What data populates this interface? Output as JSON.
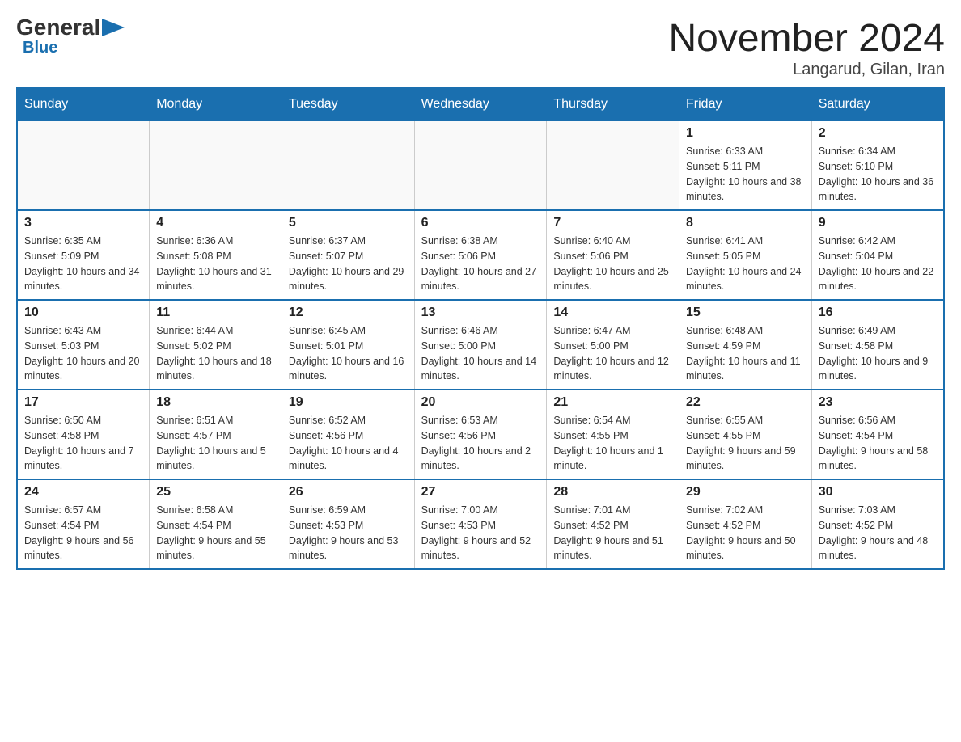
{
  "logo": {
    "general": "General",
    "blue": "Blue",
    "triangle_char": "▶"
  },
  "title": "November 2024",
  "subtitle": "Langarud, Gilan, Iran",
  "days_of_week": [
    "Sunday",
    "Monday",
    "Tuesday",
    "Wednesday",
    "Thursday",
    "Friday",
    "Saturday"
  ],
  "weeks": [
    [
      {
        "day": "",
        "info": ""
      },
      {
        "day": "",
        "info": ""
      },
      {
        "day": "",
        "info": ""
      },
      {
        "day": "",
        "info": ""
      },
      {
        "day": "",
        "info": ""
      },
      {
        "day": "1",
        "info": "Sunrise: 6:33 AM\nSunset: 5:11 PM\nDaylight: 10 hours and 38 minutes."
      },
      {
        "day": "2",
        "info": "Sunrise: 6:34 AM\nSunset: 5:10 PM\nDaylight: 10 hours and 36 minutes."
      }
    ],
    [
      {
        "day": "3",
        "info": "Sunrise: 6:35 AM\nSunset: 5:09 PM\nDaylight: 10 hours and 34 minutes."
      },
      {
        "day": "4",
        "info": "Sunrise: 6:36 AM\nSunset: 5:08 PM\nDaylight: 10 hours and 31 minutes."
      },
      {
        "day": "5",
        "info": "Sunrise: 6:37 AM\nSunset: 5:07 PM\nDaylight: 10 hours and 29 minutes."
      },
      {
        "day": "6",
        "info": "Sunrise: 6:38 AM\nSunset: 5:06 PM\nDaylight: 10 hours and 27 minutes."
      },
      {
        "day": "7",
        "info": "Sunrise: 6:40 AM\nSunset: 5:06 PM\nDaylight: 10 hours and 25 minutes."
      },
      {
        "day": "8",
        "info": "Sunrise: 6:41 AM\nSunset: 5:05 PM\nDaylight: 10 hours and 24 minutes."
      },
      {
        "day": "9",
        "info": "Sunrise: 6:42 AM\nSunset: 5:04 PM\nDaylight: 10 hours and 22 minutes."
      }
    ],
    [
      {
        "day": "10",
        "info": "Sunrise: 6:43 AM\nSunset: 5:03 PM\nDaylight: 10 hours and 20 minutes."
      },
      {
        "day": "11",
        "info": "Sunrise: 6:44 AM\nSunset: 5:02 PM\nDaylight: 10 hours and 18 minutes."
      },
      {
        "day": "12",
        "info": "Sunrise: 6:45 AM\nSunset: 5:01 PM\nDaylight: 10 hours and 16 minutes."
      },
      {
        "day": "13",
        "info": "Sunrise: 6:46 AM\nSunset: 5:00 PM\nDaylight: 10 hours and 14 minutes."
      },
      {
        "day": "14",
        "info": "Sunrise: 6:47 AM\nSunset: 5:00 PM\nDaylight: 10 hours and 12 minutes."
      },
      {
        "day": "15",
        "info": "Sunrise: 6:48 AM\nSunset: 4:59 PM\nDaylight: 10 hours and 11 minutes."
      },
      {
        "day": "16",
        "info": "Sunrise: 6:49 AM\nSunset: 4:58 PM\nDaylight: 10 hours and 9 minutes."
      }
    ],
    [
      {
        "day": "17",
        "info": "Sunrise: 6:50 AM\nSunset: 4:58 PM\nDaylight: 10 hours and 7 minutes."
      },
      {
        "day": "18",
        "info": "Sunrise: 6:51 AM\nSunset: 4:57 PM\nDaylight: 10 hours and 5 minutes."
      },
      {
        "day": "19",
        "info": "Sunrise: 6:52 AM\nSunset: 4:56 PM\nDaylight: 10 hours and 4 minutes."
      },
      {
        "day": "20",
        "info": "Sunrise: 6:53 AM\nSunset: 4:56 PM\nDaylight: 10 hours and 2 minutes."
      },
      {
        "day": "21",
        "info": "Sunrise: 6:54 AM\nSunset: 4:55 PM\nDaylight: 10 hours and 1 minute."
      },
      {
        "day": "22",
        "info": "Sunrise: 6:55 AM\nSunset: 4:55 PM\nDaylight: 9 hours and 59 minutes."
      },
      {
        "day": "23",
        "info": "Sunrise: 6:56 AM\nSunset: 4:54 PM\nDaylight: 9 hours and 58 minutes."
      }
    ],
    [
      {
        "day": "24",
        "info": "Sunrise: 6:57 AM\nSunset: 4:54 PM\nDaylight: 9 hours and 56 minutes."
      },
      {
        "day": "25",
        "info": "Sunrise: 6:58 AM\nSunset: 4:54 PM\nDaylight: 9 hours and 55 minutes."
      },
      {
        "day": "26",
        "info": "Sunrise: 6:59 AM\nSunset: 4:53 PM\nDaylight: 9 hours and 53 minutes."
      },
      {
        "day": "27",
        "info": "Sunrise: 7:00 AM\nSunset: 4:53 PM\nDaylight: 9 hours and 52 minutes."
      },
      {
        "day": "28",
        "info": "Sunrise: 7:01 AM\nSunset: 4:52 PM\nDaylight: 9 hours and 51 minutes."
      },
      {
        "day": "29",
        "info": "Sunrise: 7:02 AM\nSunset: 4:52 PM\nDaylight: 9 hours and 50 minutes."
      },
      {
        "day": "30",
        "info": "Sunrise: 7:03 AM\nSunset: 4:52 PM\nDaylight: 9 hours and 48 minutes."
      }
    ]
  ]
}
